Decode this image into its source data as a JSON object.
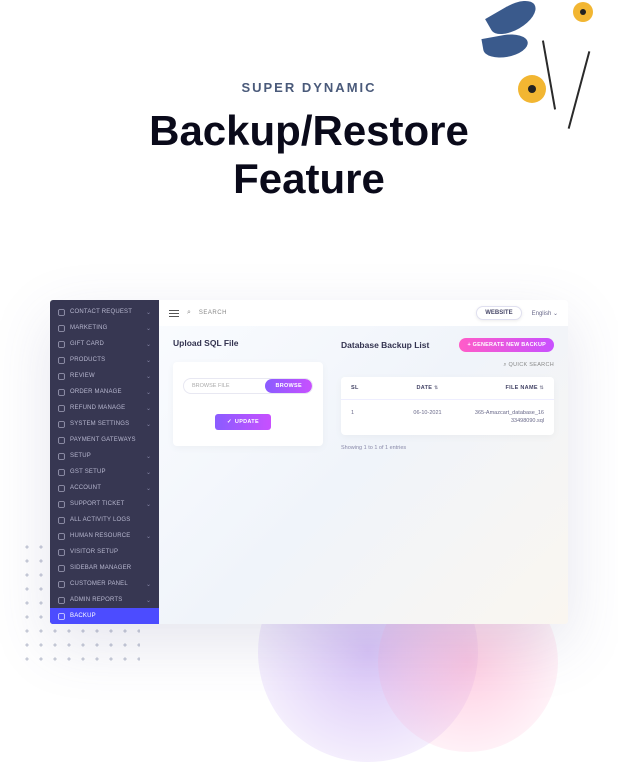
{
  "hero": {
    "eyebrow": "SUPER DYNAMIC",
    "headline_l1": "Backup/Restore",
    "headline_l2": "Feature"
  },
  "sidebar": {
    "items": [
      {
        "icon": "user",
        "label": "CONTACT REQUEST",
        "arrow": true
      },
      {
        "icon": "chart",
        "label": "MARKETING",
        "arrow": true
      },
      {
        "icon": "gift",
        "label": "GIFT CARD",
        "arrow": true
      },
      {
        "icon": "box",
        "label": "PRODUCTS",
        "arrow": true
      },
      {
        "icon": "star",
        "label": "REVIEW",
        "arrow": true
      },
      {
        "icon": "cart",
        "label": "ORDER MANAGE",
        "arrow": true
      },
      {
        "icon": "refund",
        "label": "REFUND MANAGE",
        "arrow": true
      },
      {
        "icon": "gear",
        "label": "SYSTEM SETTINGS",
        "arrow": true
      },
      {
        "icon": "card",
        "label": "PAYMENT GATEWAYS",
        "arrow": false
      },
      {
        "icon": "wrench",
        "label": "SETUP",
        "arrow": true
      },
      {
        "icon": "percent",
        "label": "GST SETUP",
        "arrow": true
      },
      {
        "icon": "person",
        "label": "ACCOUNT",
        "arrow": true
      },
      {
        "icon": "ticket",
        "label": "SUPPORT TICKET",
        "arrow": true
      },
      {
        "icon": "clock",
        "label": "ALL ACTIVITY LOGS",
        "arrow": false
      },
      {
        "icon": "people",
        "label": "HUMAN RESOURCE",
        "arrow": true
      },
      {
        "icon": "eye",
        "label": "VISITOR SETUP",
        "arrow": false
      },
      {
        "icon": "layout",
        "label": "SIDEBAR MANAGER",
        "arrow": false
      },
      {
        "icon": "panel",
        "label": "CUSTOMER PANEL",
        "arrow": true
      },
      {
        "icon": "report",
        "label": "ADMIN REPORTS",
        "arrow": true
      },
      {
        "icon": "db",
        "label": "BACKUP",
        "arrow": false,
        "active": true
      }
    ]
  },
  "topbar": {
    "search_label": "SEARCH",
    "website_btn": "WEBSITE",
    "language": "English"
  },
  "upload": {
    "title": "Upload SQL File",
    "browse_placeholder": "BROWSE FILE",
    "browse_btn": "BROWSE",
    "update_btn": "UPDATE"
  },
  "backup_list": {
    "title": "Database Backup List",
    "generate_btn": "+ GENERATE NEW BACKUP",
    "quick_search": "QUICK SEARCH",
    "columns": {
      "sl": "SL",
      "date": "DATE",
      "filename": "FILE NAME"
    },
    "rows": [
      {
        "sl": "1",
        "date": "06-10-2021",
        "filename": "365-Amazcart_database_1633498090.sql"
      }
    ],
    "entries_text": "Showing 1 to 1 of 1 entries"
  }
}
